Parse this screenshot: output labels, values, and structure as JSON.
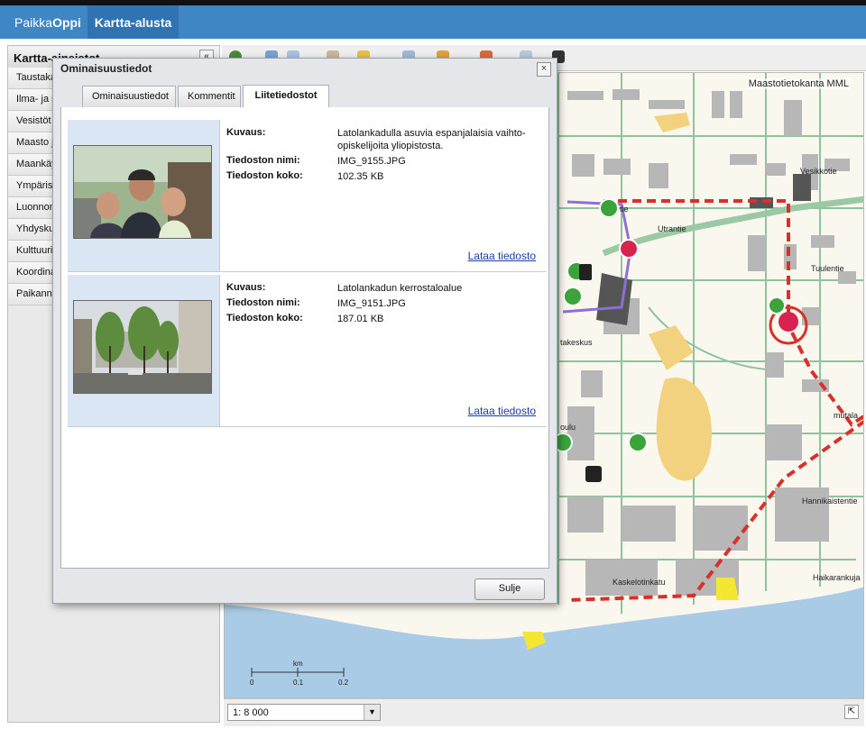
{
  "header": {
    "brand_prefix": "Paikka",
    "brand_suffix": "Oppi",
    "active_tab": "Kartta-alusta"
  },
  "sidebar": {
    "title": "Kartta-aineistot",
    "collapse_label": "«",
    "items": [
      {
        "label": "Taustaka"
      },
      {
        "label": "Ilma- ja s"
      },
      {
        "label": "Vesistöt"
      },
      {
        "label": "Maasto j"
      },
      {
        "label": "Maankäy"
      },
      {
        "label": "Ympärist"
      },
      {
        "label": "Luonnon"
      },
      {
        "label": "Yhdyskur"
      },
      {
        "label": "Kulttuuri"
      },
      {
        "label": "Koordina"
      },
      {
        "label": "Paikanni"
      }
    ]
  },
  "map": {
    "credit": "Maastotietokanta MML",
    "scalebar_labels": [
      "0",
      "0.1",
      "0.2"
    ],
    "scalebar_unit": "km",
    "street_labels": [
      "Utrantie",
      "Tuulentie",
      "Vesikkotie",
      "Haikarankuja",
      "Kaskelotinkatu",
      "Hannikaistentie",
      "takeskus",
      "oulu",
      "tie",
      "mutala"
    ]
  },
  "statusbar": {
    "scale_value": "1: 8 000",
    "dropdown_glyph": "▼",
    "corner_glyph": "⇱"
  },
  "dialog": {
    "title": "Ominaisuustiedot",
    "close_glyph": "×",
    "tabs": [
      {
        "label": "Ominaisuustiedot",
        "active": false
      },
      {
        "label": "Kommentit",
        "active": false
      },
      {
        "label": "Liitetiedostot",
        "active": true
      }
    ],
    "field_labels": {
      "description": "Kuvaus:",
      "filename": "Tiedoston nimi:",
      "filesize": "Tiedoston koko:"
    },
    "attachments": [
      {
        "description": "Latolankadulla asuvia espanjalaisia vaihto-opiskelijoita yliopistosta.",
        "filename": "IMG_9155.JPG",
        "filesize": "102.35 KB",
        "download": "Lataa tiedosto"
      },
      {
        "description": "Latolankadun kerrostaloalue",
        "filename": "IMG_9151.JPG",
        "filesize": "187.01 KB",
        "download": "Lataa tiedosto"
      }
    ],
    "close_button": "Sulje"
  }
}
